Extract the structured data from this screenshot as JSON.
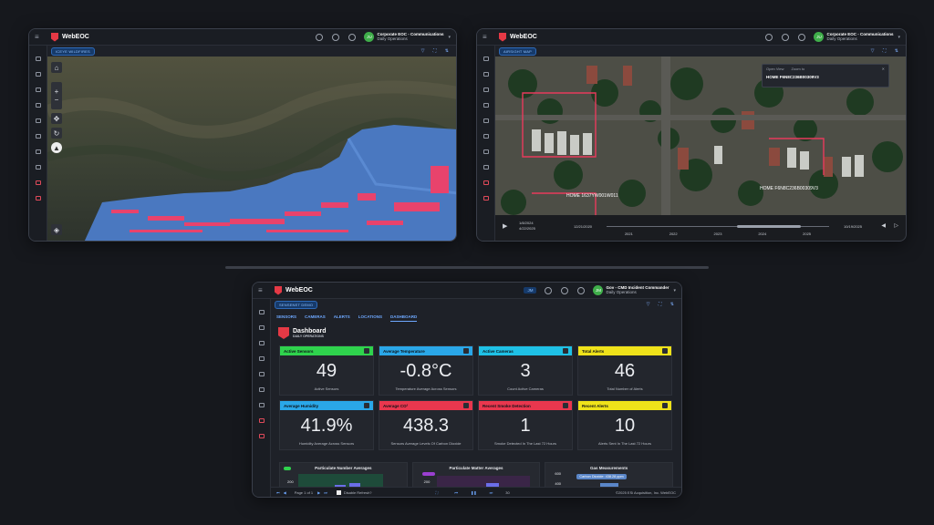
{
  "app": {
    "brand": "WebEOC"
  },
  "windows": {
    "wildfires": {
      "user": {
        "initials": "JU",
        "position": "Corporate EOC - Communications",
        "context": "Daily Operations"
      },
      "chip": "ICEYE WILDFIRES"
    },
    "airsight": {
      "user": {
        "initials": "JU",
        "position": "Corporate EOC - Communications",
        "context": "Daily Operations"
      },
      "chip": "AIRSIGHT MAP",
      "popup": {
        "open_view": "Open View",
        "zoom_to": "Zoom to",
        "title": "HOME F6N8C236B00309V3"
      },
      "map_labels": {
        "home_a": "HOME 1637YW001W011",
        "home_b": "HOME F6N8C236B00309V3"
      },
      "timeline": {
        "date_a": "1/8/2024",
        "date_b": "4/22/2025",
        "start": "12/21/2020",
        "end": "10/19/2025",
        "years": [
          "2021",
          "2022",
          "2023",
          "2024",
          "2025"
        ]
      }
    },
    "dashboard": {
      "user": {
        "initials": "JM",
        "position": "Gov - CMD Incident Commander",
        "context": "Daily Operations",
        "badge": "JM"
      },
      "chip": "SENSENET DEMO",
      "tabs": [
        "SENSORS",
        "CAMERAS",
        "ALERTS",
        "LOCATIONS",
        "DASHBOARD"
      ],
      "heading": {
        "title": "Dashboard",
        "subtitle": "DAILY OPERATIONS"
      },
      "cards": [
        {
          "label": "Active Sensors",
          "value": "49",
          "desc": "Active Sensors",
          "color": "#2fd34d"
        },
        {
          "label": "Average Temperature",
          "value": "-0.8°C",
          "desc": "Temperature Average Across Sensors",
          "color": "#2aa7e8"
        },
        {
          "label": "Active Cameras",
          "value": "3",
          "desc": "Count Active Cameras",
          "color": "#1fc1e6"
        },
        {
          "label": "Total Alerts",
          "value": "46",
          "desc": "Total Number of Alerts",
          "color": "#efe21a"
        },
        {
          "label": "Average Humidity",
          "value": "41.9%",
          "desc": "Humidity Average Across Sensors",
          "color": "#2aa7e8"
        },
        {
          "label": "Average CO²",
          "value": "438.3",
          "desc": "Sensors Average Levels Of Carbon Dioxide",
          "color": "#e9374e"
        },
        {
          "label": "Recent Smoke Detection",
          "value": "1",
          "desc": "Smoke Detected In The Last 72 Hours",
          "color": "#e9374e"
        },
        {
          "label": "Recent Alerts",
          "value": "10",
          "desc": "Alerts Sent In The Last 72 Hours",
          "color": "#efe21a"
        }
      ],
      "minis": [
        {
          "title": "Particulate Number Averages",
          "tick": "200"
        },
        {
          "title": "Particulate Matter Averages",
          "tick": "200"
        },
        {
          "title": "Gas Measurements",
          "tick_a": "600",
          "tick_b": "400",
          "tooltip": "Carbon Dioxide: 438.28 ppm"
        }
      ],
      "footer": {
        "page": "Page 1 of 1",
        "refresh": "Disable Refresh?",
        "size": "30",
        "copyright": "©2025 ESi Acquisition, Inc. WebEOC"
      }
    }
  }
}
